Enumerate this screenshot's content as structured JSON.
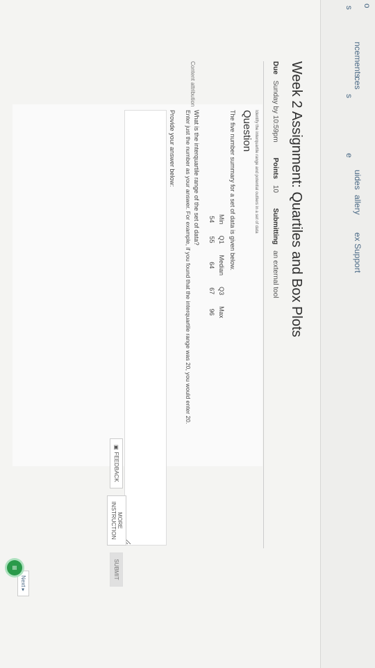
{
  "nav": {
    "items": [
      "o",
      "s",
      "ncements",
      "ces",
      "s",
      "e",
      "uides",
      "allery",
      "ex",
      "Support"
    ]
  },
  "assignment": {
    "title": "Week 2 Assignment: Quartiles and Box Plots",
    "due_label": "Due",
    "due_value": "Sunday by 10:59pm",
    "points_label": "Points",
    "points_value": "10",
    "submitting_label": "Submitting",
    "submitting_value": "an external tool"
  },
  "question": {
    "subtitle": "Identify the interquartile range and potential outliers in a set of data",
    "heading": "Question",
    "intro": "The five number summary for a set of data is given below.",
    "table": {
      "headers": [
        "Min",
        "Q1",
        "Median",
        "Q3",
        "Max"
      ],
      "values": [
        "54",
        "55",
        "64",
        "67",
        "96"
      ]
    },
    "q1": "What is the interquartile range of the set of data?",
    "q2": "Enter just the number as your answer. For example, if you found that the interquartile range was 20, you would enter 20.",
    "prompt": "Provide your answer below:"
  },
  "buttons": {
    "feedback": "FEEDBACK",
    "more": "MORE INSTRUCTION",
    "submit": "SUBMIT"
  },
  "footer": {
    "attribution": "Content attribution",
    "next": "Next ▸"
  },
  "icons": {
    "chat": "chat-icon",
    "feedback": "feedback-icon"
  }
}
